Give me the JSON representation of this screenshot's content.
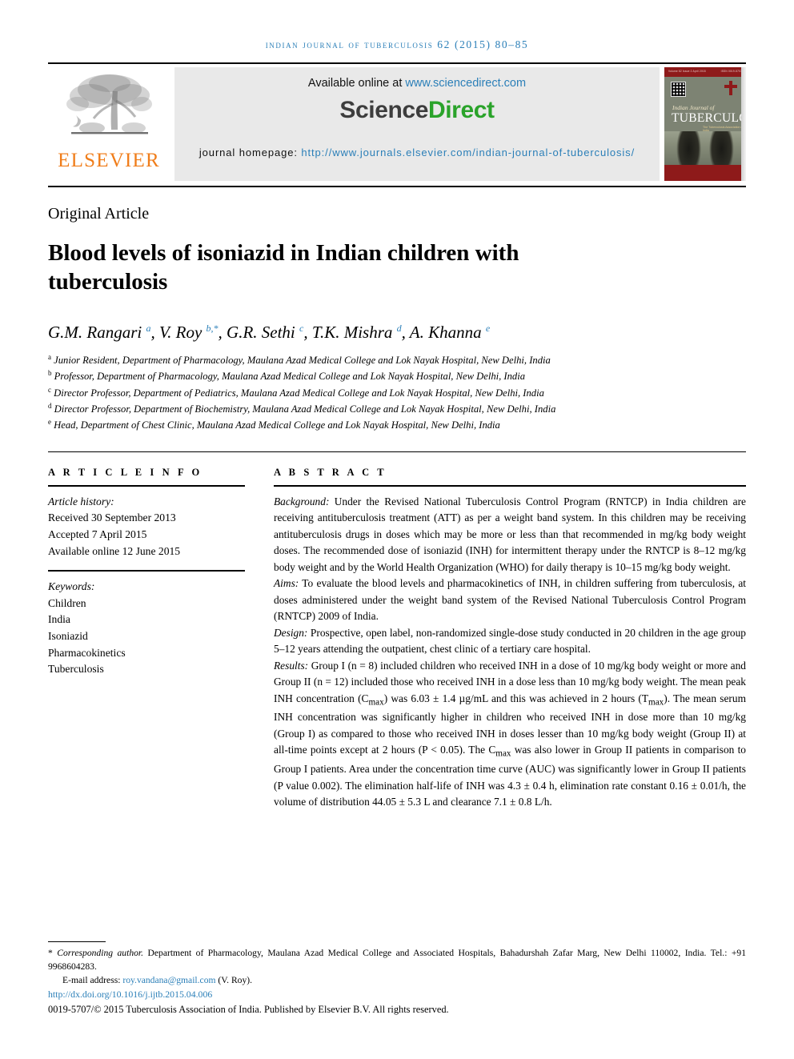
{
  "running_head": "INDIAN JOURNAL OF TUBERCULOSIS 62 (2015) 80–85",
  "masthead": {
    "publisher_name": "ELSEVIER",
    "available_label": "Available online at ",
    "available_url": "www.sciencedirect.com",
    "wordmark_first": "Science",
    "wordmark_second": "Direct",
    "homepage_label": "journal homepage: ",
    "homepage_url": "http://www.journals.elsevier.com/indian-journal-of-tuberculosis/",
    "cover": {
      "band_left": "Volume 62 Issue 2   April 2015",
      "band_right": "ISSN 0019-5707",
      "title_italic": "Indian Journal of",
      "title_main": "TUBERCULOSIS",
      "subtitle": "The Tuberculosis Association of India"
    },
    "colors": {
      "link_blue": "#2b7fb8",
      "sciencedirect_green": "#2aa32a",
      "elsevier_orange": "#f07d1a",
      "cover_red": "#8e1a1a",
      "banner_gray": "#e9e9e9"
    }
  },
  "article": {
    "kicker": "Original Article",
    "title": "Blood levels of isoniazid in Indian children with tuberculosis",
    "authors_html": "G.M. Rangari <sup>a</sup>, V. Roy <sup>b,*</sup>, G.R. Sethi <sup>c</sup>, T.K. Mishra <sup>d</sup>, A. Khanna <sup>e</sup>",
    "affiliations": [
      {
        "marker": "a",
        "text": "Junior Resident, Department of Pharmacology, Maulana Azad Medical College and Lok Nayak Hospital, New Delhi, India"
      },
      {
        "marker": "b",
        "text": "Professor, Department of Pharmacology, Maulana Azad Medical College and Lok Nayak Hospital, New Delhi, India"
      },
      {
        "marker": "c",
        "text": "Director Professor, Department of Pediatrics, Maulana Azad Medical College and Lok Nayak Hospital, New Delhi, India"
      },
      {
        "marker": "d",
        "text": "Director Professor, Department of Biochemistry, Maulana Azad Medical College and Lok Nayak Hospital, New Delhi, India"
      },
      {
        "marker": "e",
        "text": "Head, Department of Chest Clinic, Maulana Azad Medical College and Lok Nayak Hospital, New Delhi, India"
      }
    ]
  },
  "article_info": {
    "heading": "A R T I C L E   I N F O",
    "history_label": "Article history:",
    "history": [
      "Received 30 September 2013",
      "Accepted 7 April 2015",
      "Available online 12 June 2015"
    ],
    "keywords_label": "Keywords:",
    "keywords": [
      "Children",
      "India",
      "Isoniazid",
      "Pharmacokinetics",
      "Tuberculosis"
    ]
  },
  "abstract": {
    "heading": "A B S T R A C T",
    "sections": [
      {
        "lead": "Background:",
        "body": " Under the Revised National Tuberculosis Control Program (RNTCP) in India children are receiving antituberculosis treatment (ATT) as per a weight band system. In this children may be receiving antituberculosis drugs in doses which may be more or less than that recommended in mg/kg body weight doses. The recommended dose of isoniazid (INH) for intermittent therapy under the RNTCP is 8–12 mg/kg body weight and by the World Health Organization (WHO) for daily therapy is 10–15 mg/kg body weight."
      },
      {
        "lead": "Aims:",
        "body": " To evaluate the blood levels and pharmacokinetics of INH, in children suffering from tuberculosis, at doses administered under the weight band system of the Revised National Tuberculosis Control Program (RNTCP) 2009 of India."
      },
      {
        "lead": "Design:",
        "body": " Prospective, open label, non-randomized single-dose study conducted in 20 children in the age group 5–12 years attending the outpatient, chest clinic of a tertiary care hospital."
      },
      {
        "lead": "Results:",
        "body_html": " Group I (n = 8) included children who received INH in a dose of 10 mg/kg body weight or more and Group II (n = 12) included those who received INH in a dose less than 10 mg/kg body weight. The mean peak INH concentration (C<sub>max</sub>) was 6.03 ± 1.4 µg/mL and this was achieved in 2 hours (T<sub>max</sub>). The mean serum INH concentration was significantly higher in children who received INH in dose more than 10 mg/kg (Group I) as compared to those who received INH in doses lesser than 10 mg/kg body weight (Group II) at all-time points except at 2 hours (P &lt; 0.05). The C<sub>max</sub> was also lower in Group II patients in comparison to Group I patients. Area under the concentration time curve (AUC) was significantly lower in Group II patients (P value 0.002). The elimination half-life of INH was 4.3 ± 0.4 h, elimination rate constant 0.16 ± 0.01/h, the volume of distribution 44.05 ± 5.3 L and clearance 7.1 ± 0.8 L/h."
      }
    ]
  },
  "footer": {
    "corresponding_marker": "*",
    "corresponding_label": "Corresponding author.",
    "corresponding_text": " Department of Pharmacology, Maulana Azad Medical College and Associated Hospitals, Bahadurshah Zafar Marg, New Delhi 110002, India. Tel.: +91 9968604283.",
    "email_label": "E-mail address: ",
    "email": "roy.vandana@gmail.com",
    "email_suffix": " (V. Roy).",
    "doi": "http://dx.doi.org/10.1016/j.ijtb.2015.04.006",
    "copyright": "0019-5707/© 2015 Tuberculosis Association of India. Published by Elsevier B.V. All rights reserved."
  }
}
